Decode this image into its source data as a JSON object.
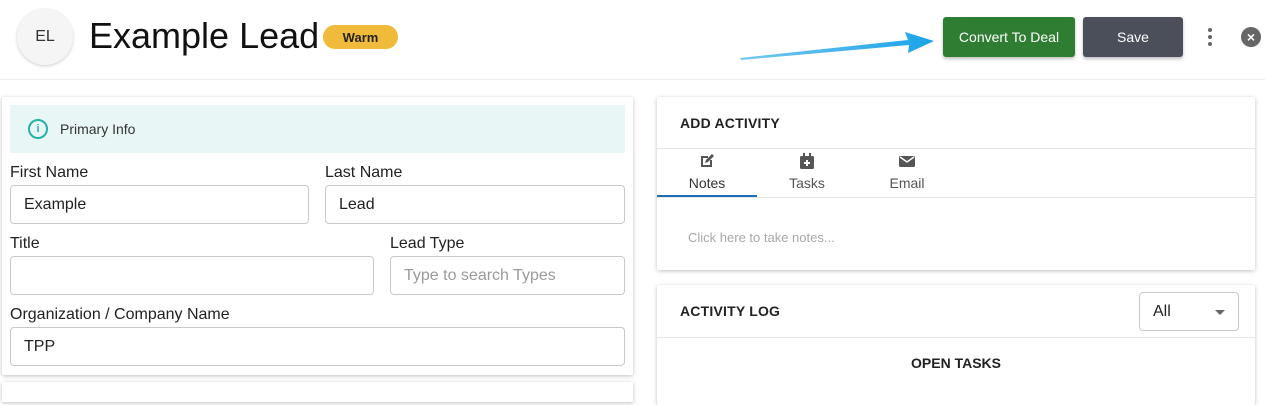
{
  "header": {
    "avatar_initials": "EL",
    "lead_name": "Example Lead",
    "status_badge": "Warm",
    "convert_label": "Convert To Deal",
    "save_label": "Save"
  },
  "primary_info": {
    "title": "Primary Info",
    "fields": {
      "first_name": {
        "label": "First Name",
        "value": "Example"
      },
      "last_name": {
        "label": "Last Name",
        "value": "Lead"
      },
      "title": {
        "label": "Title",
        "value": ""
      },
      "lead_type": {
        "label": "Lead Type",
        "placeholder": "Type to search Types"
      },
      "organization": {
        "label": "Organization / Company Name",
        "value": "TPP"
      }
    }
  },
  "add_activity": {
    "title": "ADD ACTIVITY",
    "tabs": [
      {
        "label": "Notes",
        "icon": "edit-icon",
        "active": true
      },
      {
        "label": "Tasks",
        "icon": "calendar-icon",
        "active": false
      },
      {
        "label": "Email",
        "icon": "email-icon",
        "active": false
      }
    ],
    "notes_placeholder": "Click here to take notes..."
  },
  "activity_log": {
    "title": "ACTIVITY LOG",
    "filter_selected": "All",
    "open_tasks_label": "OPEN TASKS"
  },
  "colors": {
    "convert_button": "#2e7d32",
    "save_button": "#4a4f5a",
    "warm_badge": "#f0bb3a",
    "info_bar": "#e8f6f5",
    "info_icon": "#26b3a6",
    "active_tab_underline": "#1e6fb8",
    "annotation_arrow": "#1aa3e8"
  }
}
